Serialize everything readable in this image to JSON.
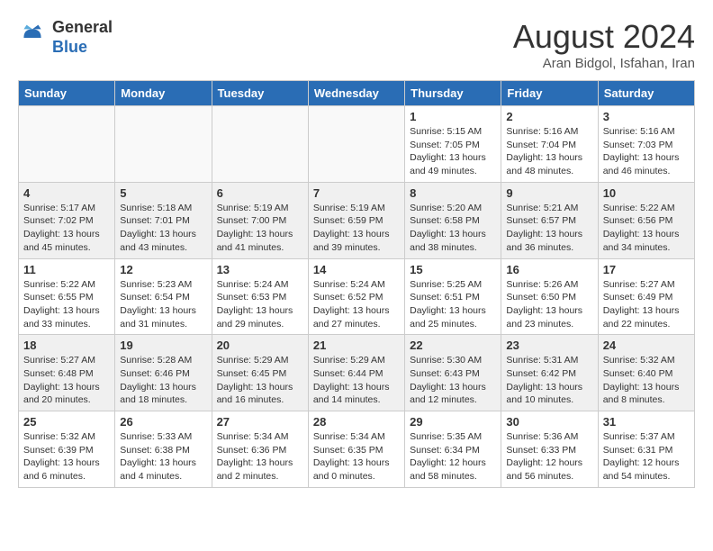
{
  "header": {
    "logo_general": "General",
    "logo_blue": "Blue",
    "month_title": "August 2024",
    "location": "Aran Bidgol, Isfahan, Iran"
  },
  "weekdays": [
    "Sunday",
    "Monday",
    "Tuesday",
    "Wednesday",
    "Thursday",
    "Friday",
    "Saturday"
  ],
  "weeks": [
    [
      {
        "day": "",
        "info": ""
      },
      {
        "day": "",
        "info": ""
      },
      {
        "day": "",
        "info": ""
      },
      {
        "day": "",
        "info": ""
      },
      {
        "day": "1",
        "info": "Sunrise: 5:15 AM\nSunset: 7:05 PM\nDaylight: 13 hours\nand 49 minutes."
      },
      {
        "day": "2",
        "info": "Sunrise: 5:16 AM\nSunset: 7:04 PM\nDaylight: 13 hours\nand 48 minutes."
      },
      {
        "day": "3",
        "info": "Sunrise: 5:16 AM\nSunset: 7:03 PM\nDaylight: 13 hours\nand 46 minutes."
      }
    ],
    [
      {
        "day": "4",
        "info": "Sunrise: 5:17 AM\nSunset: 7:02 PM\nDaylight: 13 hours\nand 45 minutes."
      },
      {
        "day": "5",
        "info": "Sunrise: 5:18 AM\nSunset: 7:01 PM\nDaylight: 13 hours\nand 43 minutes."
      },
      {
        "day": "6",
        "info": "Sunrise: 5:19 AM\nSunset: 7:00 PM\nDaylight: 13 hours\nand 41 minutes."
      },
      {
        "day": "7",
        "info": "Sunrise: 5:19 AM\nSunset: 6:59 PM\nDaylight: 13 hours\nand 39 minutes."
      },
      {
        "day": "8",
        "info": "Sunrise: 5:20 AM\nSunset: 6:58 PM\nDaylight: 13 hours\nand 38 minutes."
      },
      {
        "day": "9",
        "info": "Sunrise: 5:21 AM\nSunset: 6:57 PM\nDaylight: 13 hours\nand 36 minutes."
      },
      {
        "day": "10",
        "info": "Sunrise: 5:22 AM\nSunset: 6:56 PM\nDaylight: 13 hours\nand 34 minutes."
      }
    ],
    [
      {
        "day": "11",
        "info": "Sunrise: 5:22 AM\nSunset: 6:55 PM\nDaylight: 13 hours\nand 33 minutes."
      },
      {
        "day": "12",
        "info": "Sunrise: 5:23 AM\nSunset: 6:54 PM\nDaylight: 13 hours\nand 31 minutes."
      },
      {
        "day": "13",
        "info": "Sunrise: 5:24 AM\nSunset: 6:53 PM\nDaylight: 13 hours\nand 29 minutes."
      },
      {
        "day": "14",
        "info": "Sunrise: 5:24 AM\nSunset: 6:52 PM\nDaylight: 13 hours\nand 27 minutes."
      },
      {
        "day": "15",
        "info": "Sunrise: 5:25 AM\nSunset: 6:51 PM\nDaylight: 13 hours\nand 25 minutes."
      },
      {
        "day": "16",
        "info": "Sunrise: 5:26 AM\nSunset: 6:50 PM\nDaylight: 13 hours\nand 23 minutes."
      },
      {
        "day": "17",
        "info": "Sunrise: 5:27 AM\nSunset: 6:49 PM\nDaylight: 13 hours\nand 22 minutes."
      }
    ],
    [
      {
        "day": "18",
        "info": "Sunrise: 5:27 AM\nSunset: 6:48 PM\nDaylight: 13 hours\nand 20 minutes."
      },
      {
        "day": "19",
        "info": "Sunrise: 5:28 AM\nSunset: 6:46 PM\nDaylight: 13 hours\nand 18 minutes."
      },
      {
        "day": "20",
        "info": "Sunrise: 5:29 AM\nSunset: 6:45 PM\nDaylight: 13 hours\nand 16 minutes."
      },
      {
        "day": "21",
        "info": "Sunrise: 5:29 AM\nSunset: 6:44 PM\nDaylight: 13 hours\nand 14 minutes."
      },
      {
        "day": "22",
        "info": "Sunrise: 5:30 AM\nSunset: 6:43 PM\nDaylight: 13 hours\nand 12 minutes."
      },
      {
        "day": "23",
        "info": "Sunrise: 5:31 AM\nSunset: 6:42 PM\nDaylight: 13 hours\nand 10 minutes."
      },
      {
        "day": "24",
        "info": "Sunrise: 5:32 AM\nSunset: 6:40 PM\nDaylight: 13 hours\nand 8 minutes."
      }
    ],
    [
      {
        "day": "25",
        "info": "Sunrise: 5:32 AM\nSunset: 6:39 PM\nDaylight: 13 hours\nand 6 minutes."
      },
      {
        "day": "26",
        "info": "Sunrise: 5:33 AM\nSunset: 6:38 PM\nDaylight: 13 hours\nand 4 minutes."
      },
      {
        "day": "27",
        "info": "Sunrise: 5:34 AM\nSunset: 6:36 PM\nDaylight: 13 hours\nand 2 minutes."
      },
      {
        "day": "28",
        "info": "Sunrise: 5:34 AM\nSunset: 6:35 PM\nDaylight: 13 hours\nand 0 minutes."
      },
      {
        "day": "29",
        "info": "Sunrise: 5:35 AM\nSunset: 6:34 PM\nDaylight: 12 hours\nand 58 minutes."
      },
      {
        "day": "30",
        "info": "Sunrise: 5:36 AM\nSunset: 6:33 PM\nDaylight: 12 hours\nand 56 minutes."
      },
      {
        "day": "31",
        "info": "Sunrise: 5:37 AM\nSunset: 6:31 PM\nDaylight: 12 hours\nand 54 minutes."
      }
    ]
  ]
}
